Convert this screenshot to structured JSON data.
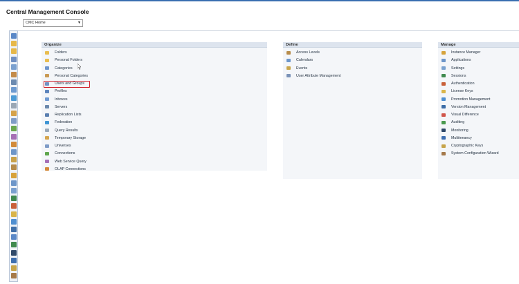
{
  "app": {
    "title": "Central Management Console"
  },
  "nav": {
    "selected": "CMC Home"
  },
  "sidebar_toolbar": [
    {
      "icon": "refresh-icon",
      "color": "#5a88c7"
    },
    {
      "icon": "folder-icon",
      "color": "#e6b84a"
    },
    {
      "icon": "folder-icon",
      "color": "#e6b84a"
    },
    {
      "icon": "users-icon",
      "color": "#6f8fc2"
    },
    {
      "icon": "category-icon",
      "color": "#7aa0cf"
    },
    {
      "icon": "category-icon",
      "color": "#c38b4a"
    },
    {
      "icon": "servers-icon",
      "color": "#6b8ab0"
    },
    {
      "icon": "inbox-icon",
      "color": "#6d9ad0"
    },
    {
      "icon": "federation-icon",
      "color": "#4c9bd6"
    },
    {
      "icon": "query-icon",
      "color": "#9aa7b5"
    },
    {
      "icon": "storage-icon",
      "color": "#d5a24a"
    },
    {
      "icon": "universe-icon",
      "color": "#7f9cc6"
    },
    {
      "icon": "connection-icon",
      "color": "#6aa84f"
    },
    {
      "icon": "web-service-icon",
      "color": "#a56fb5"
    },
    {
      "icon": "olap-icon",
      "color": "#d28b3a"
    },
    {
      "icon": "calendar-icon",
      "color": "#6d96c9"
    },
    {
      "icon": "event-icon",
      "color": "#c9a24a"
    },
    {
      "icon": "access-icon",
      "color": "#b58b4a"
    },
    {
      "icon": "instance-icon",
      "color": "#d7a23a"
    },
    {
      "icon": "application-icon",
      "color": "#6d96c9"
    },
    {
      "icon": "settings-icon",
      "color": "#7aa0cf"
    },
    {
      "icon": "session-icon",
      "color": "#3f8a4f"
    },
    {
      "icon": "auth-icon",
      "color": "#c9603a"
    },
    {
      "icon": "key-icon",
      "color": "#d9b44a"
    },
    {
      "icon": "promotion-icon",
      "color": "#4f8fd0"
    },
    {
      "icon": "version-icon",
      "color": "#3f6fa8"
    },
    {
      "icon": "visual-diff-icon",
      "color": "#5a88c7"
    },
    {
      "icon": "audit-icon",
      "color": "#3f8a4f"
    },
    {
      "icon": "monitor-icon",
      "color": "#2f4a6b"
    },
    {
      "icon": "multitenancy-icon",
      "color": "#3d6fb0"
    },
    {
      "icon": "crypto-icon",
      "color": "#c7a54a"
    },
    {
      "icon": "wizard-icon",
      "color": "#a57a4a"
    }
  ],
  "panels": {
    "organize": {
      "title": "Organize",
      "items": [
        {
          "label": "Folders",
          "icon": "folder-icon",
          "color": "#e9bd4f"
        },
        {
          "label": "Personal Folders",
          "icon": "personal-folder-icon",
          "color": "#e9bd4f"
        },
        {
          "label": "Categories",
          "icon": "categories-icon",
          "color": "#6e95cc"
        },
        {
          "label": "Personal Categories",
          "icon": "personal-categories-icon",
          "color": "#c99a55"
        },
        {
          "label": "Users and Groups",
          "icon": "users-groups-icon",
          "color": "#7392c4"
        },
        {
          "label": "Profiles",
          "icon": "profiles-icon",
          "color": "#5d85bd"
        },
        {
          "label": "Inboxes",
          "icon": "inbox-icon",
          "color": "#6f9ad2"
        },
        {
          "label": "Servers",
          "icon": "servers-icon",
          "color": "#6a88ac"
        },
        {
          "label": "Replication Lists",
          "icon": "replication-icon",
          "color": "#5a7fb0"
        },
        {
          "label": "Federation",
          "icon": "federation-icon",
          "color": "#3e95d4"
        },
        {
          "label": "Query Results",
          "icon": "query-results-icon",
          "color": "#9aa9b9"
        },
        {
          "label": "Temporary Storage",
          "icon": "temporary-storage-icon",
          "color": "#d5a54e"
        },
        {
          "label": "Universes",
          "icon": "universes-icon",
          "color": "#7f9cc7"
        },
        {
          "label": "Connections",
          "icon": "connections-icon",
          "color": "#5fa64e"
        },
        {
          "label": "Web Service Query",
          "icon": "web-service-query-icon",
          "color": "#a56fb7"
        },
        {
          "label": "OLAP Connections",
          "icon": "olap-connections-icon",
          "color": "#d4893a"
        }
      ]
    },
    "define": {
      "title": "Define",
      "items": [
        {
          "label": "Access Levels",
          "icon": "access-levels-icon",
          "color": "#b88c4b"
        },
        {
          "label": "Calendars",
          "icon": "calendars-icon",
          "color": "#6d97cb"
        },
        {
          "label": "Events",
          "icon": "events-icon",
          "color": "#c9a64c"
        },
        {
          "label": "User Attribute Management",
          "icon": "user-attribute-icon",
          "color": "#7b93b8"
        }
      ]
    },
    "manage": {
      "title": "Manage",
      "items": [
        {
          "label": "Instance Manager",
          "icon": "instance-manager-icon",
          "color": "#d6a33b"
        },
        {
          "label": "Applications",
          "icon": "applications-icon",
          "color": "#6d96c9"
        },
        {
          "label": "Settings",
          "icon": "settings-icon",
          "color": "#7aa2d0"
        },
        {
          "label": "Sessions",
          "icon": "sessions-icon",
          "color": "#3f8a4f"
        },
        {
          "label": "Authentication",
          "icon": "authentication-icon",
          "color": "#c85f38"
        },
        {
          "label": "License Keys",
          "icon": "license-keys-icon",
          "color": "#dbb64a"
        },
        {
          "label": "Promotion Management",
          "icon": "promotion-management-icon",
          "color": "#4d8fd1"
        },
        {
          "label": "Version Management",
          "icon": "version-management-icon",
          "color": "#3b6ca6"
        },
        {
          "label": "Visual Difference",
          "icon": "visual-difference-icon",
          "color": "#d0554a"
        },
        {
          "label": "Auditing",
          "icon": "auditing-icon",
          "color": "#4a9a4f"
        },
        {
          "label": "Monitoring",
          "icon": "monitoring-icon",
          "color": "#2d4769"
        },
        {
          "label": "Multitenancy",
          "icon": "multitenancy-icon",
          "color": "#3c6eb1"
        },
        {
          "label": "Cryptographic Keys",
          "icon": "cryptographic-keys-icon",
          "color": "#c6a44a"
        },
        {
          "label": "System Configuration Wizard",
          "icon": "system-configuration-wizard-icon",
          "color": "#a4794b"
        }
      ]
    }
  }
}
